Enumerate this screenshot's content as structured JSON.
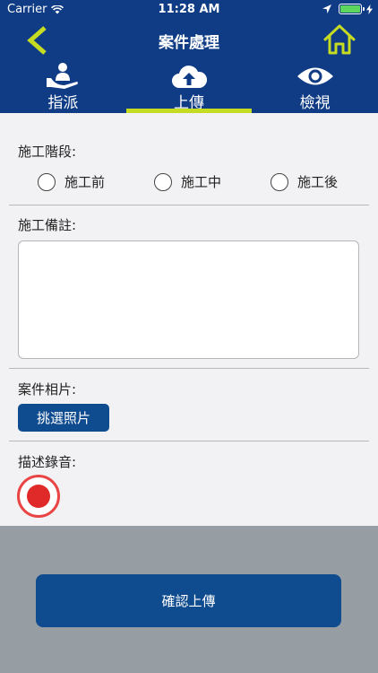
{
  "status_bar": {
    "carrier": "Carrier",
    "time": "11:28 AM"
  },
  "nav": {
    "title": "案件處理",
    "back_icon": "chevron-left-icon",
    "home_icon": "home-icon"
  },
  "tabs": [
    {
      "label": "指派",
      "icon": "assign-hand-icon",
      "active": false
    },
    {
      "label": "上傳",
      "icon": "cloud-upload-icon",
      "active": true
    },
    {
      "label": "檢視",
      "icon": "eye-icon",
      "active": false
    }
  ],
  "form": {
    "stage_label": "施工階段:",
    "stage_options": [
      "施工前",
      "施工中",
      "施工後"
    ],
    "notes_label": "施工備註:",
    "notes_value": "",
    "photos_label": "案件相片:",
    "pick_photo_label": "挑選照片",
    "recording_label": "描述錄音:"
  },
  "submit_label": "確認上傳",
  "colors": {
    "header": "#0f3c85",
    "accent": "#c6dc23",
    "button": "#0f4b8f",
    "record": "#e02a2a",
    "footer": "#969ea3"
  }
}
